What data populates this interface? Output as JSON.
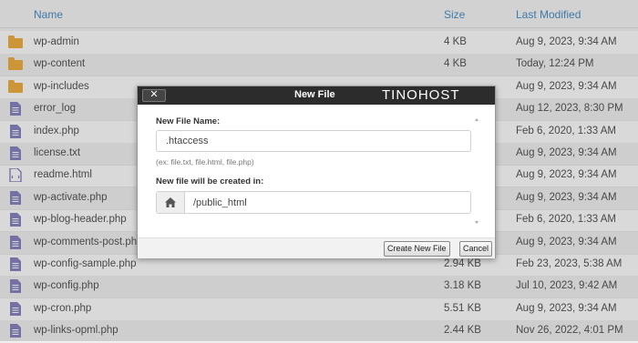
{
  "table": {
    "headers": {
      "name": "Name",
      "size": "Size",
      "modified": "Last Modified"
    },
    "rows": [
      {
        "type": "folder",
        "icon": "folder-icon",
        "name": "wp-admin",
        "size": "4 KB",
        "modified": "Aug 9, 2023, 9:34 AM"
      },
      {
        "type": "folder",
        "icon": "folder-icon",
        "name": "wp-content",
        "size": "4 KB",
        "modified": "Today, 12:24 PM"
      },
      {
        "type": "folder",
        "icon": "folder-icon",
        "name": "wp-includes",
        "size": "",
        "modified": "Aug 9, 2023, 9:34 AM"
      },
      {
        "type": "file",
        "icon": "file-text-icon",
        "name": "error_log",
        "size": "",
        "modified": "Aug 12, 2023, 8:30 PM"
      },
      {
        "type": "file",
        "icon": "file-text-icon",
        "name": "index.php",
        "size": "",
        "modified": "Feb 6, 2020, 1:33 AM"
      },
      {
        "type": "file",
        "icon": "file-text-icon",
        "name": "license.txt",
        "size": "",
        "modified": "Aug 9, 2023, 9:34 AM"
      },
      {
        "type": "html",
        "icon": "file-html-icon",
        "name": "readme.html",
        "size": "",
        "modified": "Aug 9, 2023, 9:34 AM"
      },
      {
        "type": "file",
        "icon": "file-text-icon",
        "name": "wp-activate.php",
        "size": "",
        "modified": "Aug 9, 2023, 9:34 AM"
      },
      {
        "type": "file",
        "icon": "file-text-icon",
        "name": "wp-blog-header.php",
        "size": "",
        "modified": "Feb 6, 2020, 1:33 AM"
      },
      {
        "type": "file",
        "icon": "file-text-icon",
        "name": "wp-comments-post.php",
        "size": "",
        "modified": "Aug 9, 2023, 9:34 AM"
      },
      {
        "type": "file",
        "icon": "file-text-icon",
        "name": "wp-config-sample.php",
        "size": "2.94 KB",
        "modified": "Feb 23, 2023, 5:38 AM"
      },
      {
        "type": "file",
        "icon": "file-text-icon",
        "name": "wp-config.php",
        "size": "3.18 KB",
        "modified": "Jul 10, 2023, 9:42 AM"
      },
      {
        "type": "file",
        "icon": "file-text-icon",
        "name": "wp-cron.php",
        "size": "5.51 KB",
        "modified": "Aug 9, 2023, 9:34 AM"
      },
      {
        "type": "file",
        "icon": "file-text-icon",
        "name": "wp-links-opml.php",
        "size": "2.44 KB",
        "modified": "Nov 26, 2022, 4:01 PM"
      }
    ]
  },
  "dialog": {
    "title": "New File",
    "brand": "TINOHOST",
    "close_label": "✕",
    "file_name_label": "New File Name:",
    "file_name_value": ".htaccess",
    "file_name_hint": "(ex: file.txt, file.html, file.php)",
    "location_label": "New file will be created in:",
    "location_value": "/public_html",
    "location_icon": "home-icon",
    "create_button": "Create New File",
    "cancel_button": "Cancel"
  }
}
